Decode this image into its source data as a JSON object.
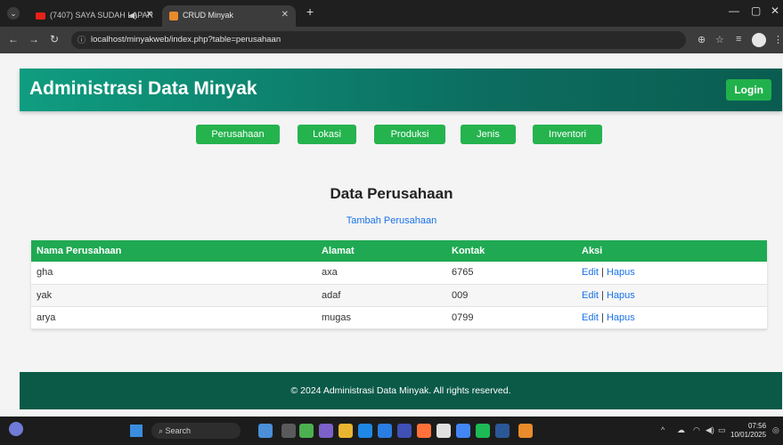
{
  "browser": {
    "tabs": [
      {
        "title": "(7407) SAYA SUDAH LAPAR",
        "active": false
      },
      {
        "title": "CRUD Minyak",
        "active": true
      }
    ],
    "url": "localhost/minyakweb/index.php?table=perusahaan"
  },
  "header": {
    "title": "Administrasi Data Minyak",
    "login_label": "Login"
  },
  "nav": {
    "items": [
      "Perusahaan",
      "Lokasi",
      "Produksi",
      "Jenis",
      "Inventori"
    ]
  },
  "content": {
    "title": "Data Perusahaan",
    "add_link": "Tambah Perusahaan",
    "table": {
      "headers": [
        "Nama Perusahaan",
        "Alamat",
        "Kontak",
        "Aksi"
      ],
      "rows": [
        {
          "nama": "gha",
          "alamat": "axa",
          "kontak": "6765",
          "edit": "Edit",
          "sep": "|",
          "hapus": "Hapus"
        },
        {
          "nama": "yak",
          "alamat": "adaf",
          "kontak": "009",
          "edit": "Edit",
          "sep": "|",
          "hapus": "Hapus"
        },
        {
          "nama": "arya",
          "alamat": "mugas",
          "kontak": "0799",
          "edit": "Edit",
          "sep": "|",
          "hapus": "Hapus"
        }
      ]
    }
  },
  "footer": {
    "text": "© 2024 Administrasi Data Minyak. All rights reserved."
  },
  "taskbar": {
    "search_label": "Search",
    "time": "07:56",
    "date": "10/01/2025"
  },
  "colors": {
    "header_start": "#0f9d80",
    "header_end": "#0a5c50",
    "button_green": "#25b34e",
    "table_header": "#1fa952",
    "footer": "#0b5a48",
    "link": "#1a73e8"
  }
}
